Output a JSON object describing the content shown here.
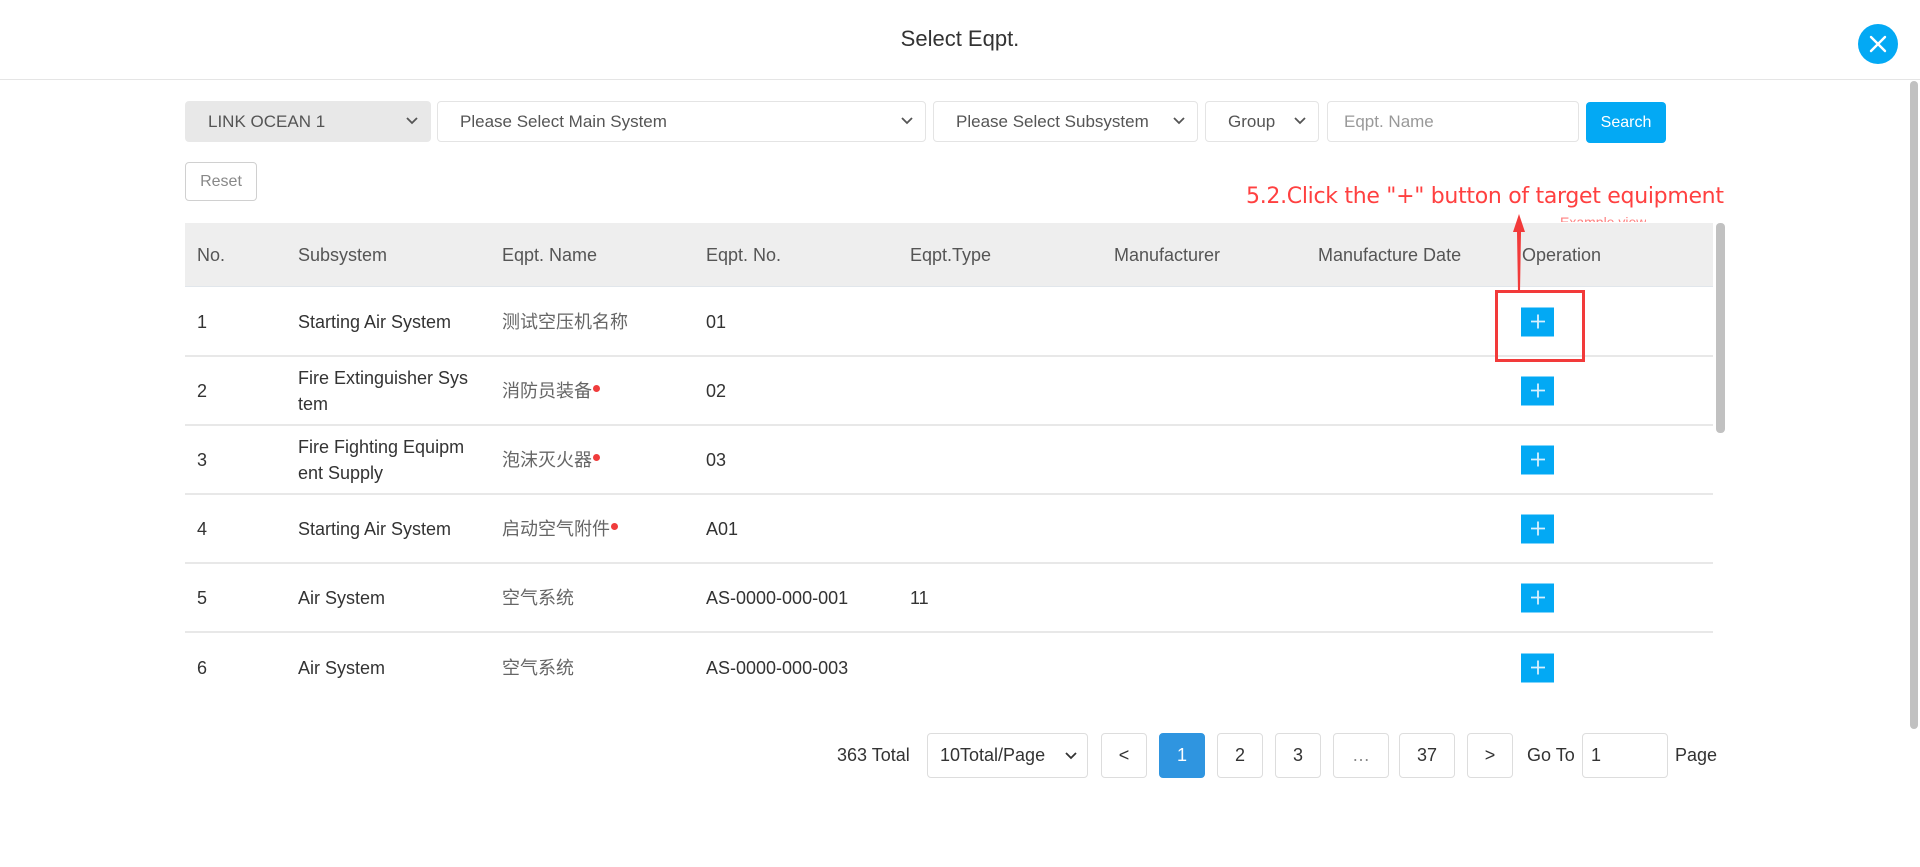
{
  "modal": {
    "title": "Select Eqpt.",
    "close_icon": "close-icon",
    "accent_color": "#03a9f4"
  },
  "filters": {
    "ship": "LINK OCEAN 1",
    "main_system_placeholder": "Please Select Main System",
    "subsystem_placeholder": "Please Select Subsystem",
    "group_placeholder": "Group",
    "eqpt_name_placeholder": "Eqpt. Name",
    "search_label": "Search",
    "reset_label": "Reset"
  },
  "annotation": {
    "text": "5.2.Click the \"+\" button of target equipment",
    "color": "#ff4040"
  },
  "table": {
    "columns": [
      "No.",
      "Subsystem",
      "Eqpt. Name",
      "Eqpt. No.",
      "Eqpt.Type",
      "Manufacturer",
      "Manufacture Date",
      "Operation"
    ],
    "rows": [
      {
        "no": "1",
        "subsystem": "Starting Air System",
        "name": "测试空压机名称",
        "flag": false,
        "eqpt_no": "01",
        "type": "",
        "manufacturer": "",
        "date": "",
        "op": "+"
      },
      {
        "no": "2",
        "subsystem": "Fire Extinguisher System",
        "subsystem_l1": "Fire Extinguisher Sys",
        "subsystem_l2": "tem",
        "name": "消防员装备",
        "flag": true,
        "eqpt_no": "02",
        "type": "",
        "manufacturer": "",
        "date": "",
        "op": "+"
      },
      {
        "no": "3",
        "subsystem": "Fire Fighting Equipment Supply",
        "subsystem_l1": "Fire Fighting Equipm",
        "subsystem_l2": "ent Supply",
        "name": "泡沫灭火器",
        "flag": true,
        "eqpt_no": "03",
        "type": "",
        "manufacturer": "",
        "date": "",
        "op": "+"
      },
      {
        "no": "4",
        "subsystem": "Starting Air System",
        "name": "启动空气附件",
        "flag": true,
        "eqpt_no": "A01",
        "type": "",
        "manufacturer": "",
        "date": "",
        "op": "+"
      },
      {
        "no": "5",
        "subsystem": "Air System",
        "name": "空气系统",
        "flag": false,
        "eqpt_no": "AS-0000-000-001",
        "type": "11",
        "manufacturer": "",
        "date": "",
        "op": "+"
      },
      {
        "no": "6",
        "subsystem": "Air System",
        "name": "空气系统",
        "flag": false,
        "eqpt_no": "AS-0000-000-003",
        "type": "",
        "manufacturer": "",
        "date": "",
        "op": "+"
      }
    ]
  },
  "pagination": {
    "total": "363 Total",
    "page_size": "10Total/Page",
    "prev": "<",
    "pages": [
      "1",
      "2",
      "3",
      "…",
      "37"
    ],
    "current_page": "1",
    "next": ">",
    "goto_label": "Go To",
    "goto_value": "1",
    "page_label": "Page"
  }
}
